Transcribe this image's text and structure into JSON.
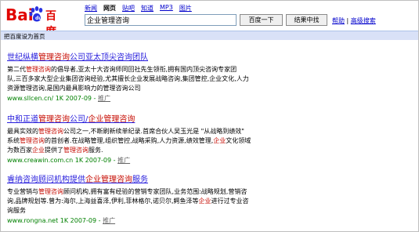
{
  "logo": {
    "part1": "Bai",
    "part2": "百度"
  },
  "tabs": [
    {
      "label": "新闻",
      "active": false
    },
    {
      "label": "网页",
      "active": true
    },
    {
      "label": "贴吧",
      "active": false
    },
    {
      "label": "知道",
      "active": false
    },
    {
      "label": "MP3",
      "active": false
    },
    {
      "label": "图片",
      "active": false
    }
  ],
  "search": {
    "value": "企业管理咨询",
    "button_primary": "百度一下",
    "button_secondary": "结果中找"
  },
  "links": {
    "help": "帮助",
    "separator": "|",
    "advanced": "高级搜索"
  },
  "homepage_bar": "把百度设为首页",
  "results": [
    {
      "title_pre": "世纪纵横",
      "title_em": "管理咨询",
      "title_post": "公司亚太顶尖咨询团队",
      "body": [
        [
          "第二代",
          ""
        ],
        [
          "管理咨询",
          "em"
        ],
        [
          "的倡导者,亚太十大咨询师同回社先生领衔,拥有国内顶尖咨询专家团",
          ""
        ]
      ],
      "body_line2": "队,三百多家大型企业集团咨询经验,尤其擅长企业发展战略咨询,集团管控,企业文化,人力",
      "body_line3": "资源管理咨询,是国内最具影响力的管理咨询公司",
      "url": "www.sllcen.cn/ 1K 2007-09",
      "sep": " - ",
      "promo": "推广"
    },
    {
      "title_pre": "中和正道",
      "title_em": "管理咨询",
      "title_mid": "公司/",
      "title_em2": "企业管理咨询",
      "body_line1_pre": "最具实效的",
      "body_line1_em": "管理咨询",
      "body_line1_post": "公司之一,不断刷新续单纪录.首席合伙人吴玉光是 \"从战略到绩效\"",
      "body_line2_pre": "系统",
      "body_line2_em": "管理咨询",
      "body_line2_mid": "的首创者.在战略管理,组织管控,战略采购,人力资源,绩效管理,",
      "body_line2_em2": "企业",
      "body_line2_post": "文化领域",
      "body_line3_pre": "为数百家",
      "body_line3_em": "企业",
      "body_line3_mid": "提供了",
      "body_line3_em2": "管理咨询",
      "body_line3_post": "服务.",
      "url": "www.creawin.com.cn 1K 2007-09",
      "sep": " - ",
      "promo": "推广"
    },
    {
      "title_pre": "睿纳咨询顾问机构提供",
      "title_em": "企业管理咨询",
      "title_post": "服务",
      "body_line1_pre": "专业营销与",
      "body_line1_em": "管理咨询",
      "body_line1_post": "顾问机构,拥有富有经验的营销专家团队,业务范围:战略规划,营销咨",
      "body_line2": "询,品牌规划等.曾为:海尔,上海益喜泽,伊利,菲林格尔,诺贝尔,鳄鱼泽等",
      "body_line2_em": "企业",
      "body_line2_post": "进行过专业咨",
      "body_line3": "询服务",
      "url": "www.rongna.net 1K 2007-09",
      "sep": " - ",
      "promo": "推广"
    }
  ]
}
